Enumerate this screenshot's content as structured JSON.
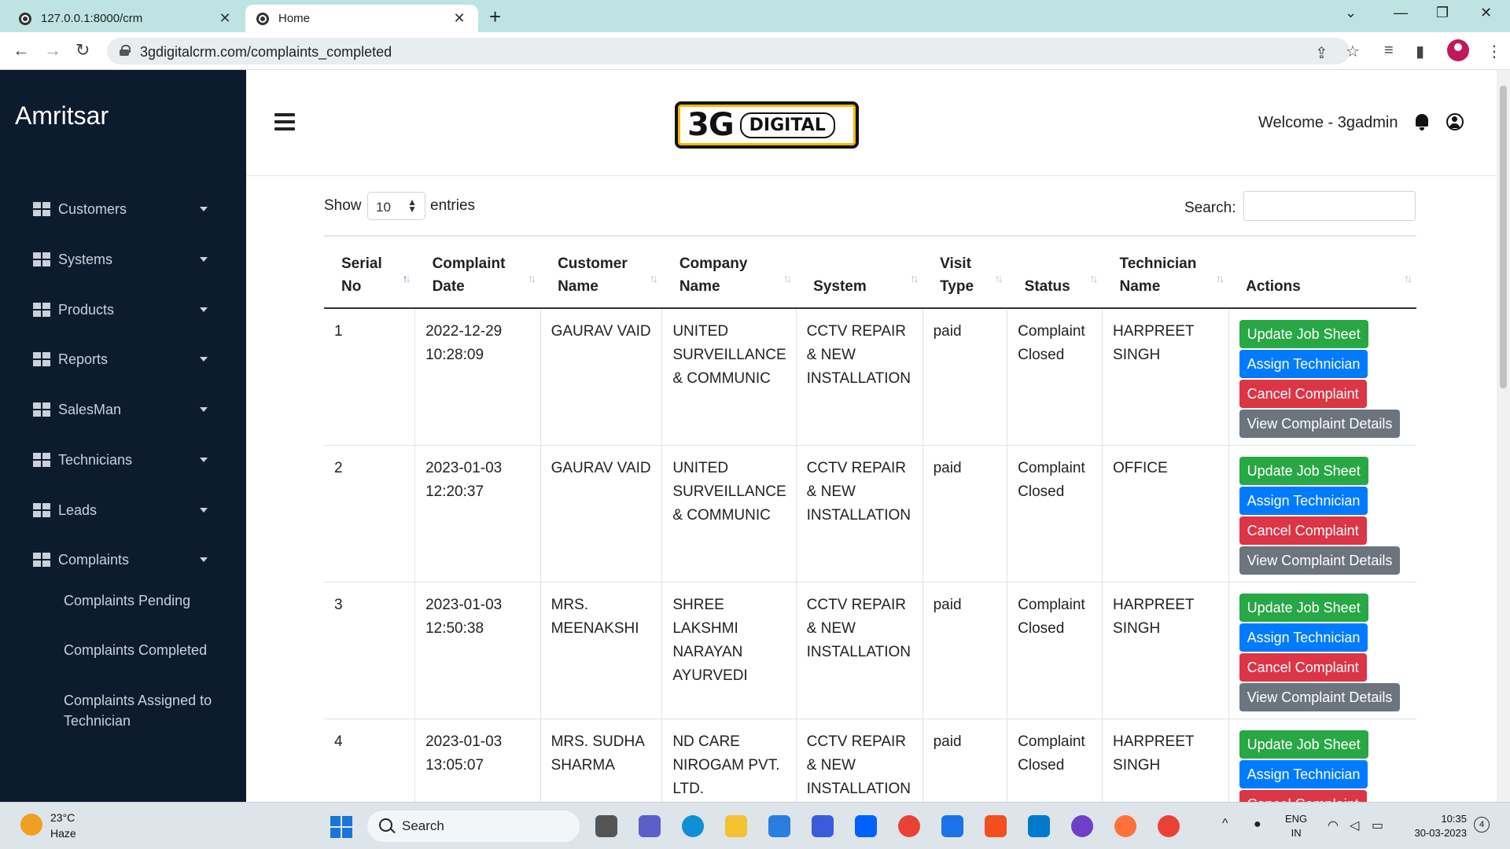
{
  "browser": {
    "tabs": [
      {
        "title": "127.0.0.1:8000/crm",
        "active": false
      },
      {
        "title": "Home",
        "active": true
      }
    ],
    "url": "3gdigitalcrm.com/complaints_completed"
  },
  "sidebar": {
    "brand": "Amritsar",
    "items": [
      {
        "label": "Customers"
      },
      {
        "label": "Systems"
      },
      {
        "label": "Products"
      },
      {
        "label": "Reports"
      },
      {
        "label": "SalesMan"
      },
      {
        "label": "Technicians"
      },
      {
        "label": "Leads"
      },
      {
        "label": "Complaints"
      }
    ],
    "subitems": [
      {
        "label": "Complaints Pending"
      },
      {
        "label": "Complaints Completed"
      },
      {
        "label": "Complaints Assigned to Technician"
      }
    ]
  },
  "header": {
    "logo_main": "3G",
    "logo_word": "DIGITAL",
    "welcome": "Welcome - 3gadmin"
  },
  "table_controls": {
    "show_label": "Show",
    "entries_value": "10",
    "entries_label": "entries",
    "search_label": "Search:"
  },
  "table": {
    "columns": [
      {
        "line1": "Serial",
        "line2": "No"
      },
      {
        "line1": "Complaint",
        "line2": "Date"
      },
      {
        "line1": "Customer",
        "line2": "Name"
      },
      {
        "line1": "Company",
        "line2": "Name"
      },
      {
        "line1": "",
        "line2": "System"
      },
      {
        "line1": "Visit",
        "line2": "Type"
      },
      {
        "line1": "",
        "line2": "Status"
      },
      {
        "line1": "Technician",
        "line2": "Name"
      },
      {
        "line1": "",
        "line2": "Actions"
      }
    ],
    "rows": [
      {
        "serial": "1",
        "date": "2022-12-29",
        "time": "10:28:09",
        "customer": "GAURAV VAID",
        "company": "UNITED SURVEILLANCE & COMMUNIC",
        "system": "CCTV REPAIR & NEW INSTALLATION",
        "visit": "paid",
        "status": "Complaint Closed",
        "technician": "HARPREET SINGH"
      },
      {
        "serial": "2",
        "date": "2023-01-03",
        "time": "12:20:37",
        "customer": "GAURAV VAID",
        "company": "UNITED SURVEILLANCE & COMMUNIC",
        "system": "CCTV REPAIR & NEW INSTALLATION",
        "visit": "paid",
        "status": "Complaint Closed",
        "technician": "OFFICE"
      },
      {
        "serial": "3",
        "date": "2023-01-03",
        "time": "12:50:38",
        "customer": "MRS. MEENAKSHI",
        "company": "SHREE LAKSHMI NARAYAN AYURVEDI",
        "system": "CCTV REPAIR & NEW INSTALLATION",
        "visit": "paid",
        "status": "Complaint Closed",
        "technician": "HARPREET SINGH"
      },
      {
        "serial": "4",
        "date": "2023-01-03",
        "time": "13:05:07",
        "customer": "MRS. SUDHA SHARMA",
        "company": "ND CARE NIROGAM PVT. LTD.",
        "system": "CCTV REPAIR & NEW INSTALLATION",
        "visit": "paid",
        "status": "Complaint Closed",
        "technician": "HARPREET SINGH"
      }
    ],
    "actions": {
      "update": "Update Job Sheet",
      "assign": "Assign Technician",
      "cancel": "Cancel Complaint",
      "view": "View Complaint Details"
    }
  },
  "taskbar": {
    "temperature": "23°C",
    "weather": "Haze",
    "search": "Search",
    "lang_line1": "ENG",
    "lang_line2": "IN",
    "time": "10:35",
    "date": "30-03-2023",
    "notifications": "4"
  },
  "colors": {
    "sidebar_bg": "#0d1b2e",
    "btn_green": "#28a745",
    "btn_blue": "#007bff",
    "btn_red": "#dc3545",
    "btn_gray": "#6c757d",
    "logo_accent": "#f5b800"
  }
}
